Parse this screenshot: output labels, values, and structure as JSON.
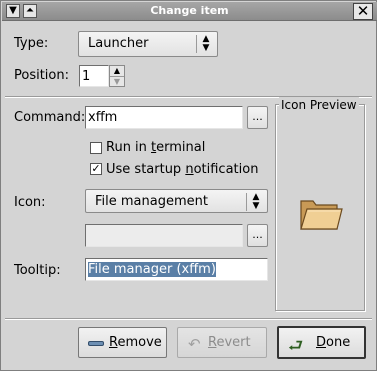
{
  "window": {
    "title": "Change item"
  },
  "type": {
    "label": "Type:",
    "value": "Launcher"
  },
  "position": {
    "label": "Position:",
    "value": "1"
  },
  "command": {
    "label": "Command:",
    "value": "xffm",
    "browse": "..."
  },
  "run_in_terminal": {
    "label_pre": "Run in ",
    "label_u": "t",
    "label_post": "erminal",
    "checked": false
  },
  "startup_notification": {
    "label_pre": "Use startup ",
    "label_u": "n",
    "label_post": "otification",
    "checked": true
  },
  "icon": {
    "label": "Icon:",
    "value": "File management",
    "path_value": "",
    "browse": "..."
  },
  "tooltip": {
    "label": "Tooltip:",
    "value": "File manager (xffm)"
  },
  "icon_preview": {
    "label": "Icon Preview",
    "icon_name": "folder-icon"
  },
  "buttons": {
    "remove": {
      "label_u": "R",
      "label_post": "emove"
    },
    "revert": {
      "label_u": "R",
      "label_post": "evert"
    },
    "done": {
      "label_u": "D",
      "label_post": "one"
    }
  }
}
